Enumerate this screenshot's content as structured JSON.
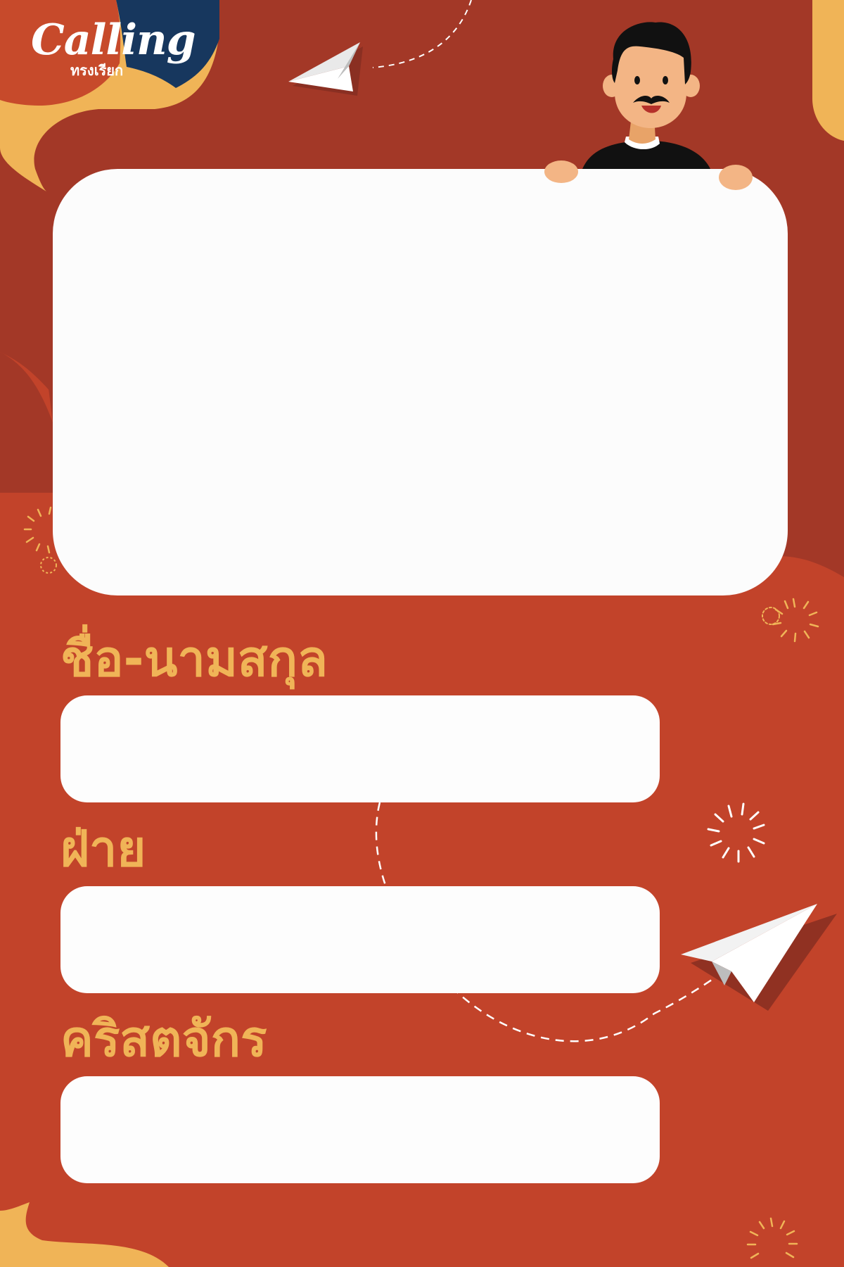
{
  "brand": {
    "logo_word": "Calling",
    "logo_subtitle": "ทรงเรียก"
  },
  "form": {
    "fields": [
      {
        "label": "ชื่อ-นามสกุล",
        "value": ""
      },
      {
        "label": "ฝ่าย",
        "value": ""
      },
      {
        "label": "คริสตจักร",
        "value": ""
      }
    ]
  },
  "colors": {
    "background": "#c2432a",
    "background_dark": "#a33827",
    "accent_yellow": "#f0b457",
    "navy": "#17375e",
    "card_white": "#fcfcfc"
  },
  "icons": [
    "paper-plane-icon",
    "firework-burst-icon",
    "character-illustration"
  ]
}
